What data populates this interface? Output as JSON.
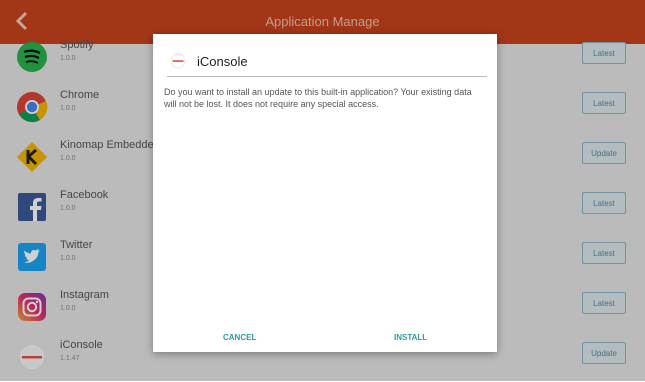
{
  "header": {
    "title": "Application Manage",
    "back_icon": "chevron-left-icon"
  },
  "apps": [
    {
      "name": "Spotify",
      "version": "1.0.0",
      "button": "Latest",
      "icon": "spotify-icon"
    },
    {
      "name": "Chrome",
      "version": "1.0.0",
      "button": "Latest",
      "icon": "chrome-icon"
    },
    {
      "name": "Kinomap Embedded",
      "version": "1.0.0",
      "button": "Update",
      "icon": "kinomap-icon"
    },
    {
      "name": "Facebook",
      "version": "1.0.0",
      "button": "Latest",
      "icon": "facebook-icon"
    },
    {
      "name": "Twitter",
      "version": "1.0.0",
      "button": "Latest",
      "icon": "twitter-icon"
    },
    {
      "name": "Instagram",
      "version": "1.0.0",
      "button": "Latest",
      "icon": "instagram-icon"
    },
    {
      "name": "iConsole",
      "version": "1.1.47",
      "button": "Update",
      "icon": "iconsole-icon"
    }
  ],
  "dialog": {
    "title": "iConsole",
    "message": "Do you want to install an update to this built-in application? Your existing data will not be lost. It does not require any special access.",
    "cancel": "CANCEL",
    "install": "INSTALL"
  },
  "colors": {
    "header": "#c6431b",
    "accent": "#2a9da0",
    "button_border": "#8fb3c4"
  }
}
